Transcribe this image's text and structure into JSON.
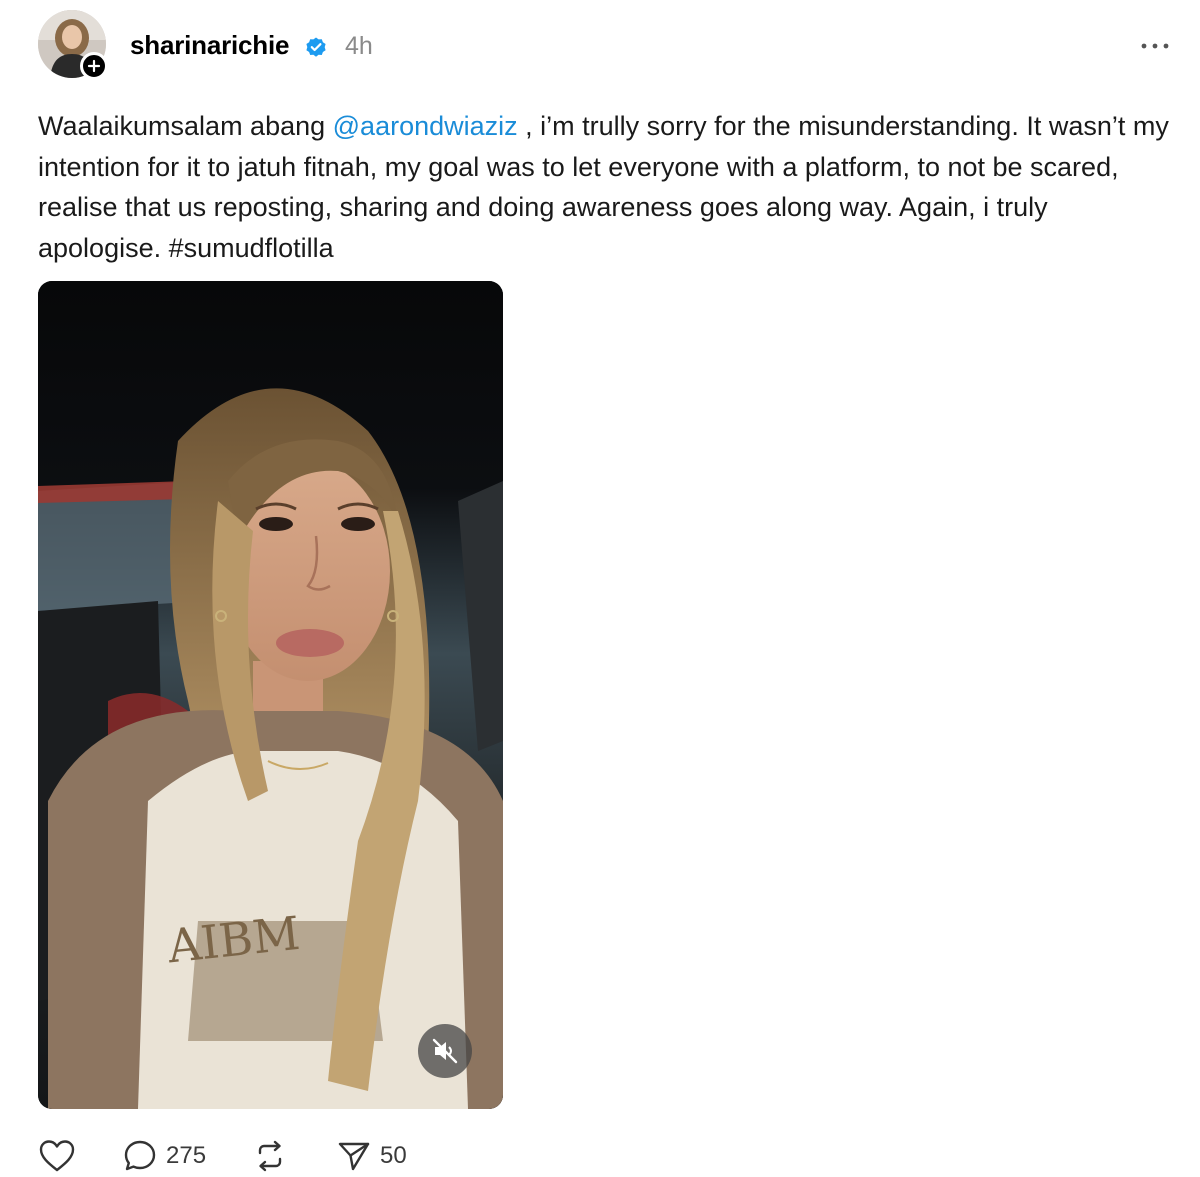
{
  "post": {
    "author": {
      "username": "sharinarichie",
      "verified": true,
      "avatar_icon": "profile-photo",
      "follow_icon": "plus-icon"
    },
    "timestamp": "4h",
    "more_icon": "more-horizontal-icon",
    "text": {
      "before_mention": "Waalaikumsalam abang ",
      "mention": "@aarondwiaziz",
      "after_mention": " , i’m trully sorry for the misunderstanding. It wasn’t my intention for it to jatuh fitnah, my goal was to let everyone with a platform, to not be scared, realise that us reposting, sharing and doing awareness goes along way. Again, i truly apologise. #sumudflotilla"
    },
    "media": {
      "type": "video",
      "mute_icon": "speaker-muted-icon",
      "muted": true
    },
    "actions": {
      "like": {
        "icon": "heart-icon",
        "count": ""
      },
      "reply": {
        "icon": "comment-icon",
        "count": "275"
      },
      "repost": {
        "icon": "repost-icon",
        "count": ""
      },
      "share": {
        "icon": "send-icon",
        "count": "50"
      }
    }
  },
  "colors": {
    "mention": "#1a8cd8",
    "verified": "#1d9bf0",
    "muted_text": "#8a8a8a",
    "text": "#1a1a1a"
  }
}
